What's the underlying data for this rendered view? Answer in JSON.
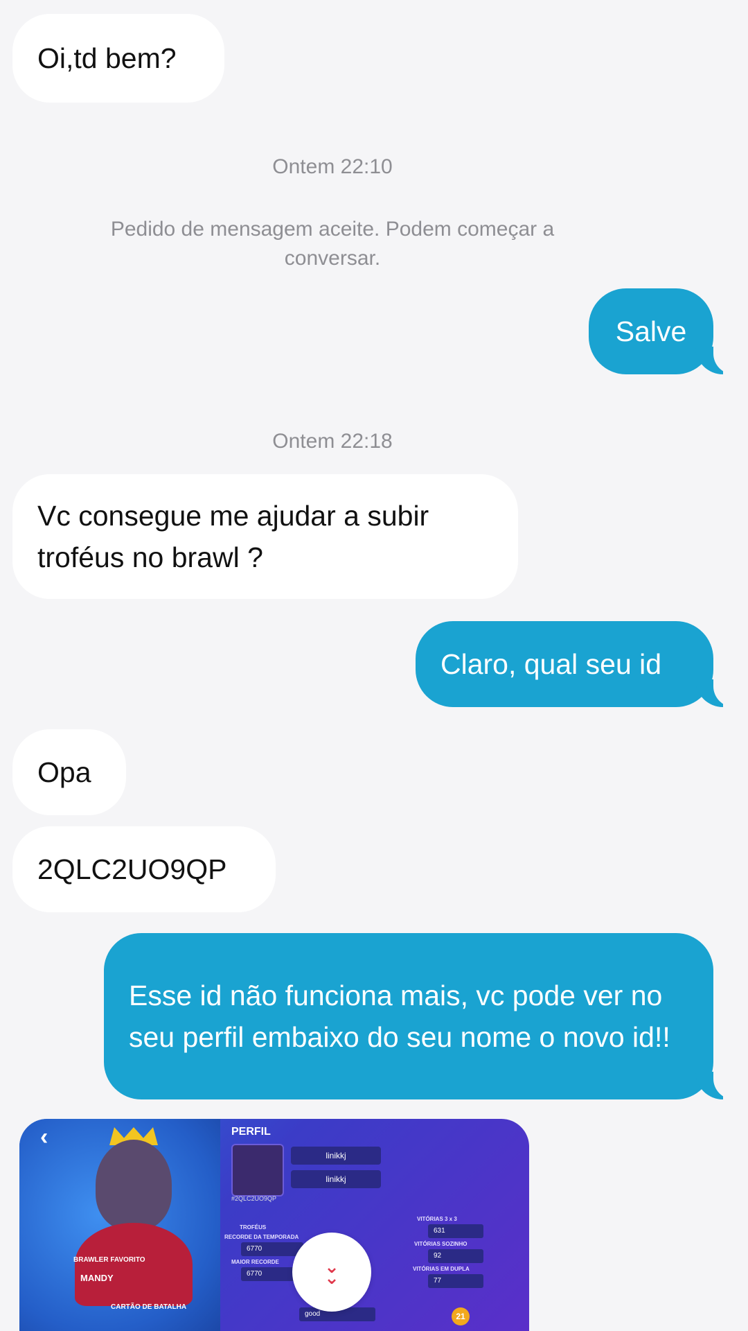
{
  "messages": {
    "m1": "Oi,td bem?",
    "ts1": "Ontem 22:10",
    "system": "Pedido de mensagem aceite. Podem começar a conversar.",
    "m2": "Salve",
    "ts2": "Ontem 22:18",
    "m3": "Vc consegue me ajudar a subir troféus no brawl ?",
    "m4": "Claro, qual seu id",
    "m5": "Opa",
    "m6": "2QLC2UO9QP",
    "m7": "Esse id não funciona mais, vc pode ver no seu perfil embaixo do seu nome o novo id!!"
  },
  "screenshot": {
    "title": "PERFIL",
    "favorite_label": "BRAWLER FAVORITO",
    "brawler": "MANDY",
    "card_label": "CARTÃO DE BATALHA",
    "name1": "linikkj",
    "name2": "linikkj",
    "tag": "#2QLC2UO9QP",
    "trophies_label": "TROFÉUS",
    "season_label": "RECORDE DA TEMPORADA",
    "season_value": "6770",
    "max_label": "MAIOR RECORDE",
    "max_value": "6770",
    "wins3_label": "VITÓRIAS 3 x 3",
    "wins3_value": "631",
    "solo_label": "VITÓRIAS SOZINHO",
    "solo_value": "92",
    "duo_label": "VITÓRIAS EM DUPLA",
    "duo_value": "77",
    "club": "good",
    "level": "21"
  },
  "colors": {
    "outgoing": "#1aa3d1",
    "incoming": "#ffffff",
    "background": "#f5f5f7"
  },
  "icons": {
    "expand": "double-chevron-down-icon",
    "back": "chevron-left-icon"
  }
}
